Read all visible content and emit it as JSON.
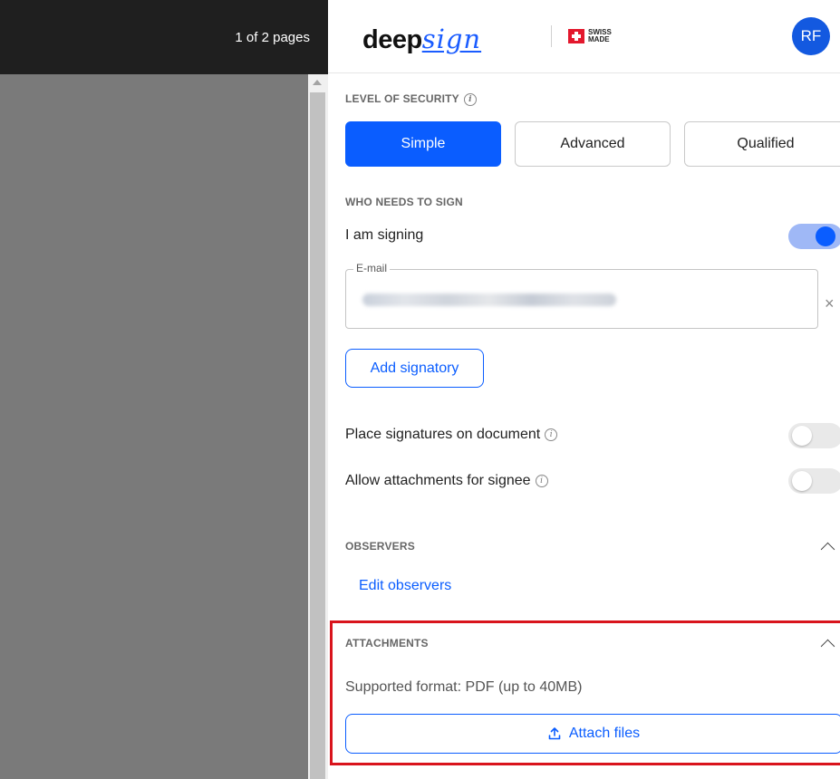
{
  "viewer": {
    "page_counter": "1 of 2 pages"
  },
  "header": {
    "logo_text_bold": "deep",
    "logo_text_script": "sign",
    "swiss_line1": "SWISS",
    "swiss_line2": "MADE",
    "avatar_initials": "RF"
  },
  "security": {
    "title": "LEVEL OF SECURITY",
    "options": [
      "Simple",
      "Advanced",
      "Qualified"
    ],
    "selected": "Simple"
  },
  "signers": {
    "title": "WHO NEEDS TO SIGN",
    "i_am_signing_label": "I am signing",
    "i_am_signing_on": true,
    "email_label": "E-mail",
    "email_value": "••••••••••••••••••••••••",
    "add_signatory_label": "Add signatory",
    "place_signatures_label": "Place signatures on document",
    "place_signatures_on": false,
    "allow_attachments_label": "Allow attachments for signee",
    "allow_attachments_on": false
  },
  "observers": {
    "title": "OBSERVERS",
    "edit_label": "Edit observers"
  },
  "attachments": {
    "title": "ATTACHMENTS",
    "supported_format": "Supported format: PDF (up to 40MB)",
    "attach_label": "Attach files"
  },
  "colors": {
    "accent": "#0a5dff",
    "highlight_box": "#d9141c"
  }
}
